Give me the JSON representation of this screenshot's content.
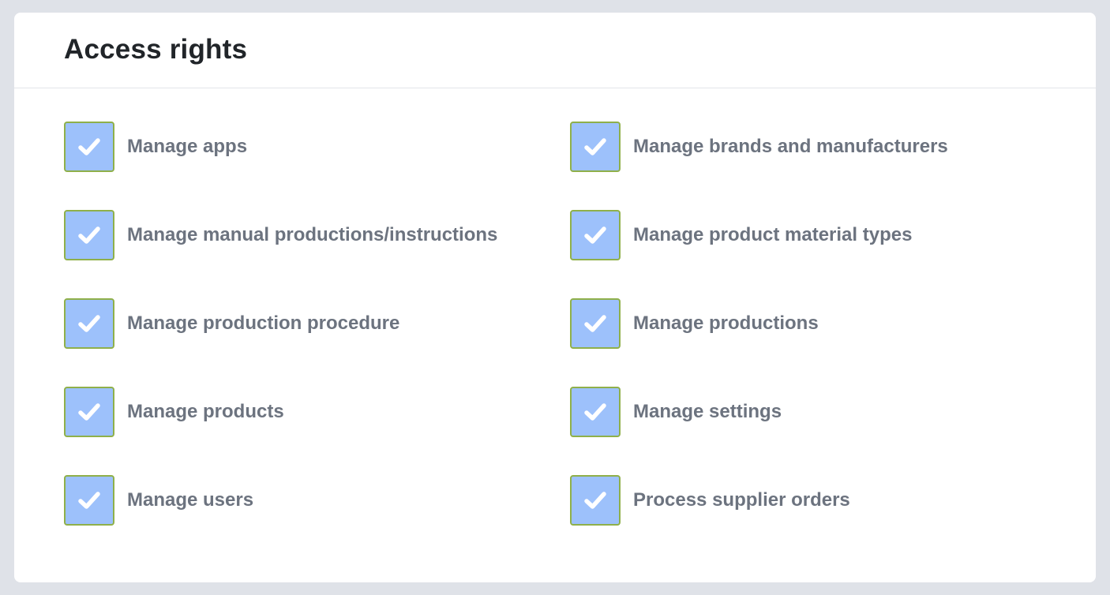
{
  "card": {
    "title": "Access rights"
  },
  "permissions": [
    {
      "label": "Manage apps",
      "checked": true
    },
    {
      "label": "Manage brands and manufacturers",
      "checked": true
    },
    {
      "label": "Manage manual productions/instructions",
      "checked": true
    },
    {
      "label": "Manage product material types",
      "checked": true
    },
    {
      "label": "Manage production procedure",
      "checked": true
    },
    {
      "label": "Manage productions",
      "checked": true
    },
    {
      "label": "Manage products",
      "checked": true
    },
    {
      "label": "Manage settings",
      "checked": true
    },
    {
      "label": "Manage users",
      "checked": true
    },
    {
      "label": "Process supplier orders",
      "checked": true
    }
  ],
  "icons": {
    "checkbox_check": "check-icon"
  },
  "colors": {
    "page_background": "#dfe2e8",
    "card_background": "#ffffff",
    "checkbox_fill": "#9dc1fb",
    "checkbox_border": "#8fb04a",
    "label_text": "#6c737f",
    "title_text": "#212529"
  }
}
